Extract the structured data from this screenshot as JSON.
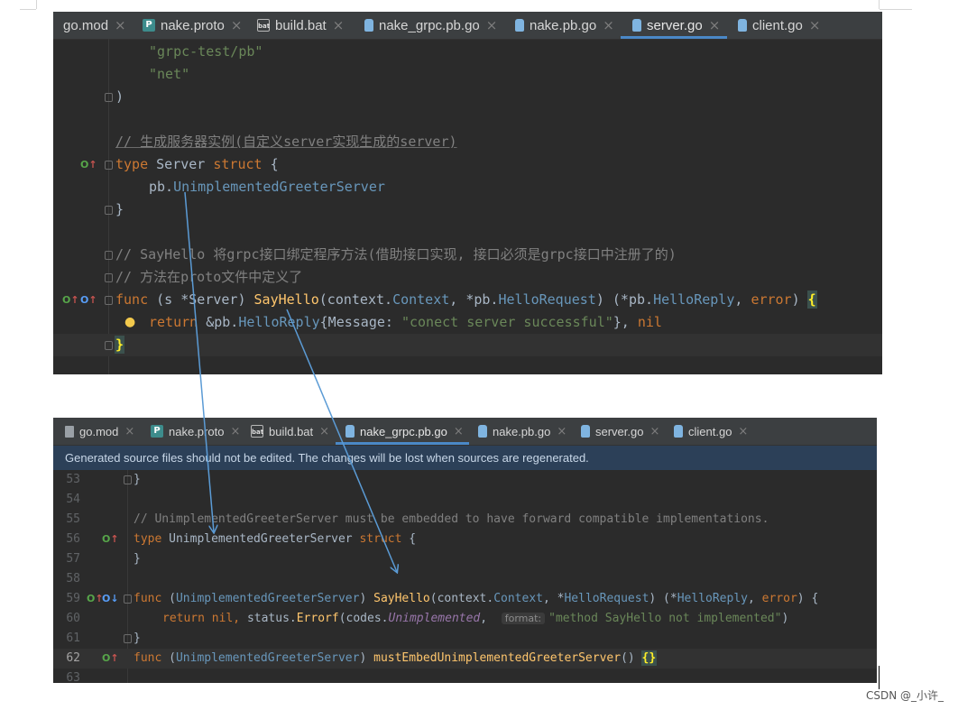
{
  "colors": {
    "editor_bg": "#2b2b2b",
    "tabbar_bg": "#3c3f41",
    "active_tab_underline": "#4a88c7",
    "arrow": "#5b9bd5"
  },
  "top_editor": {
    "tabs": [
      {
        "label": "go.mod",
        "icon": "go-mod-file-icon",
        "active": false
      },
      {
        "label": "nake.proto",
        "icon": "proto-file-icon",
        "active": false
      },
      {
        "label": "build.bat",
        "icon": "bat-file-icon",
        "active": false
      },
      {
        "label": "nake_grpc.pb.go",
        "icon": "go-file-icon",
        "active": false
      },
      {
        "label": "nake.pb.go",
        "icon": "go-file-icon",
        "active": false
      },
      {
        "label": "server.go",
        "icon": "go-file-icon",
        "active": true
      },
      {
        "label": "client.go",
        "icon": "go-file-icon",
        "active": false
      }
    ],
    "code": {
      "l1": "\"grpc-test/pb\"",
      "l2": "\"net\"",
      "l3": ")",
      "l5": "// 生成服务器实例(自定义server实现生成的server)",
      "l6_kw1": "type",
      "l6_name": " Server ",
      "l6_kw2": "struct",
      "l6_rest": " {",
      "l7_pkg": "pb.",
      "l7_type": "UnimplementedGreeterServer",
      "l8": "}",
      "l10": "// SayHello 将grpc接口绑定程序方法(借助接口实现, 接口必须是grpc接口中注册了的)",
      "l11": "// 方法在proto文件中定义了",
      "l12_func": "func",
      "l12_recv": " (s *Server) ",
      "l12_fn": "SayHello",
      "l12_p1": "(context.",
      "l12_t1": "Context",
      "l12_p2": ", *pb.",
      "l12_t2": "HelloRequest",
      "l12_p3": ") (*pb.",
      "l12_t3": "HelloReply",
      "l12_p4": ", ",
      "l12_err": "error",
      "l12_p5": ") ",
      "l12_brace": "{",
      "l13_ret": "return",
      "l13_a": " &pb.",
      "l13_t": "HelloReply",
      "l13_b": "{Message: ",
      "l13_str": "\"conect server successful\"",
      "l13_c": "}, ",
      "l13_nil": "nil",
      "l14": "}"
    }
  },
  "bottom_editor": {
    "tabs": [
      {
        "label": "go.mod",
        "icon": "go-mod-file-icon",
        "active": false
      },
      {
        "label": "nake.proto",
        "icon": "proto-file-icon",
        "active": false
      },
      {
        "label": "build.bat",
        "icon": "bat-file-icon",
        "active": false
      },
      {
        "label": "nake_grpc.pb.go",
        "icon": "go-file-icon",
        "active": true
      },
      {
        "label": "nake.pb.go",
        "icon": "go-file-icon",
        "active": false
      },
      {
        "label": "server.go",
        "icon": "go-file-icon",
        "active": false
      },
      {
        "label": "client.go",
        "icon": "go-file-icon",
        "active": false
      }
    ],
    "banner": "Generated source files should not be edited. The changes will be lost when sources are regenerated.",
    "line_numbers": [
      "53",
      "54",
      "55",
      "56",
      "57",
      "58",
      "59",
      "60",
      "61",
      "62",
      "63"
    ],
    "code": {
      "l53": "}",
      "l55": "// UnimplementedGreeterServer must be embedded to have forward compatible implementations.",
      "l56_kw": "type",
      "l56_name": " UnimplementedGreeterServer ",
      "l56_kw2": "struct",
      "l56_rest": " {",
      "l57": "}",
      "l59_func": "func",
      "l59_p0": " (",
      "l59_t0": "UnimplementedGreeterServer",
      "l59_p1": ") ",
      "l59_fn": "SayHello",
      "l59_p2": "(context.",
      "l59_t1": "Context",
      "l59_p3": ", *",
      "l59_t2": "HelloRequest",
      "l59_p4": ") (*",
      "l59_t3": "HelloReply",
      "l59_p5": ", ",
      "l59_err": "error",
      "l59_p6": ") {",
      "l60_ret": "return",
      "l60_nil": " nil, ",
      "l60_a": "status.",
      "l60_fn": "Errorf",
      "l60_b": "(codes.",
      "l60_it": "Unimplemented",
      "l60_c": ",  ",
      "l60_hint": "format:",
      "l60_str": "\"method SayHello not implemented\"",
      "l60_d": ")",
      "l61": "}",
      "l62_func": "func",
      "l62_p0": " (",
      "l62_t0": "UnimplementedGreeterServer",
      "l62_p1": ") ",
      "l62_fn": "mustEmbedUnimplementedGreeterServer",
      "l62_p2": "() ",
      "l62_brace": "{}"
    }
  },
  "watermark": "CSDN @_小许_"
}
